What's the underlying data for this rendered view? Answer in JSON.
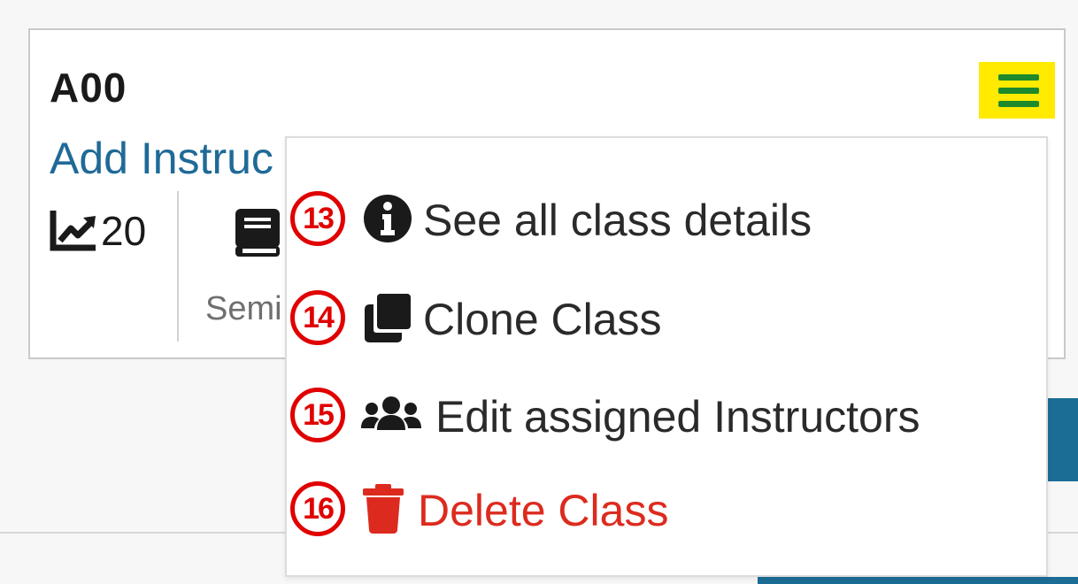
{
  "card": {
    "title": "A00",
    "add_instructor_label": "Add Instruc",
    "stat_value": "20",
    "semi_label": "Semi"
  },
  "menu": {
    "items": [
      {
        "badge": "13",
        "label": "See all class details",
        "icon": "info-circle-icon"
      },
      {
        "badge": "14",
        "label": "Clone Class",
        "icon": "clone-icon"
      },
      {
        "badge": "15",
        "label": "Edit assigned Instructors",
        "icon": "users-icon"
      },
      {
        "badge": "16",
        "label": "Delete Class",
        "icon": "trash-icon",
        "color": "#dc2b1e"
      }
    ]
  },
  "colors": {
    "link": "#1f6a97",
    "highlight": "#ffea00",
    "hamburger": "#1e8a2b",
    "annotation": "#e00000",
    "primary_button": "#1c6d96"
  }
}
